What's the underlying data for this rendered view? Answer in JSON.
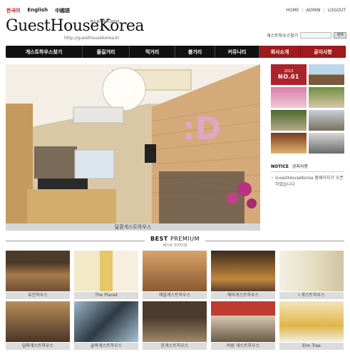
{
  "languages": [
    {
      "label": "한국어",
      "active": true
    },
    {
      "label": "English",
      "active": false
    },
    {
      "label": "中國語",
      "active": false
    }
  ],
  "utility_links": [
    "HOME",
    "ADMIN",
    "LOGOUT"
  ],
  "logo": {
    "text": "GuestHouseKorea",
    "korean": "게스트하우스코리아",
    "url": "http://guesthousekorea.kr"
  },
  "search": {
    "label": "게스트하우스찾기",
    "value": "",
    "button": "검색"
  },
  "nav": {
    "items": [
      "게스트하우스찾기",
      "즐길거리",
      "먹거리",
      "볼거리",
      "커뮤니티",
      "회사소개",
      "공지사항"
    ]
  },
  "hero": {
    "caption": "달콤게스트하우스"
  },
  "side_thumbs": {
    "badge_top": "2013",
    "badge_label": "NO.01"
  },
  "notice": {
    "title": "NOTICE",
    "subtitle": "공지사항",
    "text": "GuestHouseKorea 홈페이지가 오픈하였습니다"
  },
  "best": {
    "title_bold": "BEST",
    "title_light": "PREMIUM",
    "subtitle": "베스트 프리미엄",
    "row1": [
      "유진하우스",
      "The Planet",
      "해밀게스트하우스",
      "해아게스트하우스",
      "I 게스트하우스"
    ],
    "row2": [
      "달파게스트하우스",
      "골목게스트하우스",
      "윤게스트하우스",
      "비원 게스트하우스",
      "Elm Tree"
    ]
  },
  "colors": {
    "accent_red": "#a0191c",
    "nav_bg": "#111111"
  }
}
